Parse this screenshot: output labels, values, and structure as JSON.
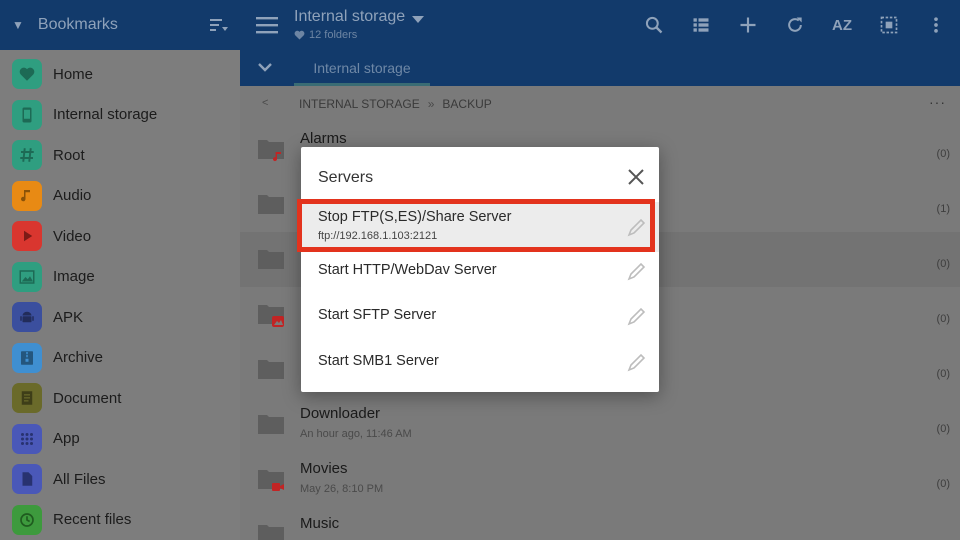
{
  "sidebar": {
    "title": "Bookmarks",
    "items": [
      {
        "label": "Home",
        "icon": "heart-icon",
        "color": "#2f9e80"
      },
      {
        "label": "Internal storage",
        "icon": "phone-icon",
        "color": "#2f9e80"
      },
      {
        "label": "Root",
        "icon": "hash-icon",
        "color": "#2f9e80"
      },
      {
        "label": "Audio",
        "icon": "music-icon",
        "color": "#e88a14"
      },
      {
        "label": "Video",
        "icon": "play-icon",
        "color": "#d9362f"
      },
      {
        "label": "Image",
        "icon": "image-icon",
        "color": "#2f9e80"
      },
      {
        "label": "APK",
        "icon": "android-icon",
        "color": "#3b4f9e"
      },
      {
        "label": "Archive",
        "icon": "archive-icon",
        "color": "#3f8fd1"
      },
      {
        "label": "Document",
        "icon": "document-icon",
        "color": "#6a6a2a"
      },
      {
        "label": "App",
        "icon": "grid-icon",
        "color": "#4a58b8"
      },
      {
        "label": "All Files",
        "icon": "file-icon",
        "color": "#4a58b8"
      },
      {
        "label": "Recent files",
        "icon": "clock-icon",
        "color": "#3d9a3d"
      }
    ]
  },
  "topbar": {
    "title": "Internal storage",
    "subtitle": "12 folders",
    "sort_label": "AZ"
  },
  "tabs": [
    {
      "label": "Internal storage"
    }
  ],
  "breadcrumb": {
    "back": "<",
    "parts": [
      "INTERNAL STORAGE",
      "BACKUP"
    ],
    "separator": "»",
    "more": "···"
  },
  "files": [
    {
      "name": "Alarms",
      "meta": "",
      "count": "(0)",
      "badge": "music"
    },
    {
      "name": "",
      "meta": "",
      "count": "(1)",
      "badge": ""
    },
    {
      "name": "",
      "meta": "",
      "count": "(0)",
      "badge": ""
    },
    {
      "name": "",
      "meta": "",
      "count": "(0)",
      "badge": "image"
    },
    {
      "name": "",
      "meta": "",
      "count": "(0)",
      "badge": ""
    },
    {
      "name": "Downloader",
      "meta": "An hour ago, 11:46 AM",
      "count": "(0)",
      "badge": ""
    },
    {
      "name": "Movies",
      "meta": "May 26, 8:10 PM",
      "count": "(0)",
      "badge": "video"
    },
    {
      "name": "Music",
      "meta": "",
      "count": "",
      "badge": ""
    }
  ],
  "dialog": {
    "title": "Servers",
    "servers": [
      {
        "label": "Stop FTP(S,ES)/Share Server",
        "sub": "ftp://192.168.1.103:2121"
      },
      {
        "label": "Start HTTP/WebDav Server",
        "sub": ""
      },
      {
        "label": "Start SFTP Server",
        "sub": ""
      },
      {
        "label": "Start SMB1 Server",
        "sub": ""
      }
    ]
  },
  "colors": {
    "topbar": "#123a6b",
    "highlight": "#e3331d"
  }
}
